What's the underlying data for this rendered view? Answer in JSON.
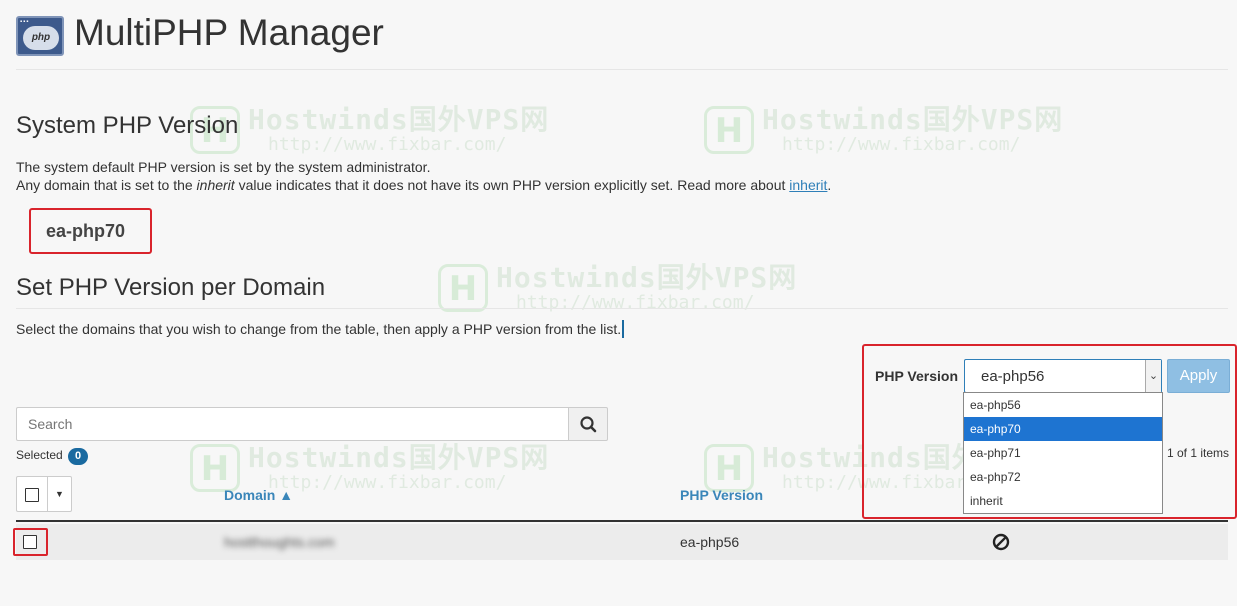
{
  "header": {
    "title": "MultiPHP Manager",
    "icon_text": "php",
    "icon": "php-app-icon"
  },
  "system": {
    "title": "System PHP Version",
    "desc_line1": "The system default PHP version is set by the system administrator.",
    "desc_line2_pre": "Any domain that is set to the ",
    "desc_line2_em": "inherit",
    "desc_line2_mid": " value indicates that it does not have its own PHP version explicitly set. Read more about ",
    "desc_link": "inherit",
    "desc_line2_post": ".",
    "version": "ea-php70"
  },
  "domain_section": {
    "title": "Set PHP Version per Domain",
    "desc": "Select the domains that you wish to change from the table, then apply a PHP version from the list."
  },
  "version_panel": {
    "label": "PHP Version",
    "selected_value": "ea-php56",
    "apply_label": "Apply",
    "options": [
      "ea-php56",
      "ea-php70",
      "ea-php71",
      "ea-php72",
      "inherit"
    ],
    "highlighted_option": "ea-php70",
    "items_count": "1 of 1 items"
  },
  "search": {
    "placeholder": "Search",
    "icon": "search-icon"
  },
  "selected": {
    "label": "Selected",
    "count": "0"
  },
  "table": {
    "columns": {
      "domain": "Domain ▲",
      "version": "PHP Version"
    },
    "rows": [
      {
        "domain": "(blurred)",
        "version": "ea-php56",
        "action_icon": "blocked-icon"
      }
    ]
  },
  "watermark": {
    "name": "Hostwinds国外VPS网",
    "url": "http://www.fixbar.com/",
    "logo": "H"
  },
  "colors": {
    "highlight_red": "#d9242c",
    "link_blue": "#2f7fb8",
    "option_selected": "#1e74d1",
    "apply_button": "#8fbfe3"
  }
}
